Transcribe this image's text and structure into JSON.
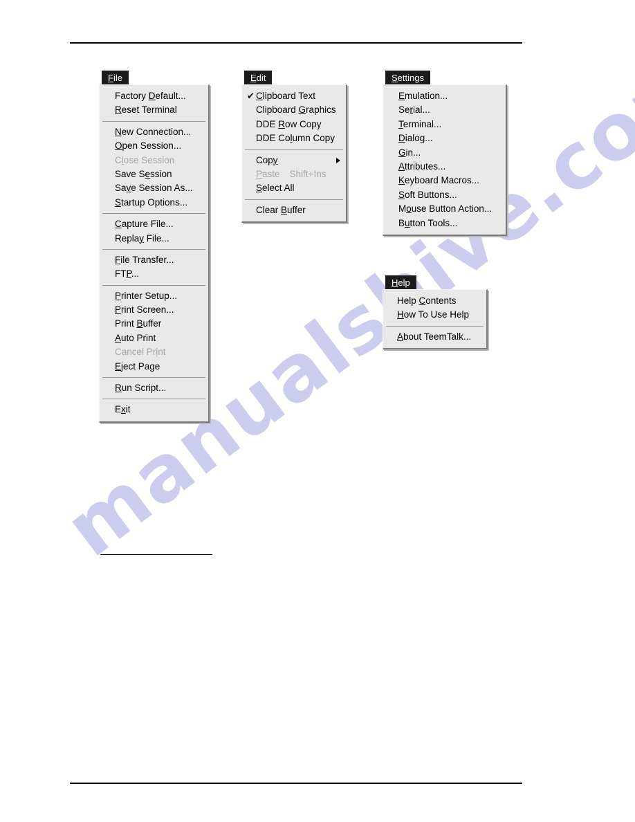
{
  "document": {
    "watermark_text": "manualshive.com",
    "watermark_color": "#ccccee",
    "rule_color": "#000000",
    "menu_bg_color": "#e9e9e9",
    "menu_title_bg_color": "#1c1c1c",
    "disabled_text_color": "#a6a6a6"
  },
  "menus": {
    "file": {
      "title": "File",
      "title_accel": "F",
      "items": [
        {
          "label": "Factory Default...",
          "accel_index": 8,
          "disabled": false
        },
        {
          "label": "Reset Terminal",
          "accel_index": 0,
          "disabled": false
        },
        {
          "separator": true
        },
        {
          "label": "New Connection...",
          "accel_index": 0,
          "disabled": false
        },
        {
          "label": "Open Session...",
          "accel_index": 0,
          "disabled": false
        },
        {
          "label": "Close Session",
          "accel_index": 1,
          "disabled": true
        },
        {
          "label": "Save Session",
          "accel_index": 6,
          "disabled": false
        },
        {
          "label": "Save Session As...",
          "accel_index": 2,
          "disabled": false
        },
        {
          "label": "Startup Options...",
          "accel_index": 0,
          "disabled": false
        },
        {
          "separator": true
        },
        {
          "label": "Capture File...",
          "accel_index": 0,
          "disabled": false
        },
        {
          "label": "Replay File...",
          "accel_index": 5,
          "disabled": false
        },
        {
          "separator": true
        },
        {
          "label": "File Transfer...",
          "accel_index": 0,
          "disabled": false
        },
        {
          "label": "FTP...",
          "accel_index": 2,
          "disabled": false
        },
        {
          "separator": true
        },
        {
          "label": "Printer Setup...",
          "accel_index": 0,
          "disabled": false
        },
        {
          "label": "Print Screen...",
          "accel_index": 0,
          "disabled": false
        },
        {
          "label": "Print Buffer",
          "accel_index": 6,
          "disabled": false
        },
        {
          "label": "Auto Print",
          "accel_index": 0,
          "disabled": false
        },
        {
          "label": "Cancel Print",
          "accel_index": 9,
          "disabled": true
        },
        {
          "label": "Eject Page",
          "accel_index": 0,
          "disabled": false
        },
        {
          "separator": true
        },
        {
          "label": "Run Script...",
          "accel_index": 0,
          "disabled": false
        },
        {
          "separator": true
        },
        {
          "label": "Exit",
          "accel_index": 1,
          "disabled": false
        }
      ]
    },
    "edit": {
      "title": "Edit",
      "title_accel": "E",
      "items": [
        {
          "label": "Clipboard Text",
          "accel_index": 0,
          "disabled": false,
          "checked": true
        },
        {
          "label": "Clipboard Graphics",
          "accel_index": 10,
          "disabled": false
        },
        {
          "label": "DDE Row Copy",
          "accel_index": 4,
          "disabled": false
        },
        {
          "label": "DDE Column Copy",
          "accel_index": 6,
          "disabled": false
        },
        {
          "separator": true
        },
        {
          "label": "Copy",
          "accel_index": 3,
          "disabled": false,
          "submenu": true
        },
        {
          "label": "Paste",
          "accel_index": 0,
          "disabled": true,
          "accel_text": "Shift+Ins"
        },
        {
          "label": "Select All",
          "accel_index": 0,
          "disabled": false
        },
        {
          "separator": true
        },
        {
          "label": "Clear Buffer",
          "accel_index": 6,
          "disabled": false
        }
      ]
    },
    "settings": {
      "title": "Settings",
      "title_accel": "S",
      "items": [
        {
          "label": "Emulation...",
          "accel_index": 0,
          "disabled": false
        },
        {
          "label": "Serial...",
          "accel_index": 2,
          "disabled": false
        },
        {
          "label": "Terminal...",
          "accel_index": 0,
          "disabled": false
        },
        {
          "label": "Dialog...",
          "accel_index": 0,
          "disabled": false
        },
        {
          "label": "Gin...",
          "accel_index": 0,
          "disabled": false
        },
        {
          "label": "Attributes...",
          "accel_index": 0,
          "disabled": false
        },
        {
          "label": "Keyboard Macros...",
          "accel_index": 0,
          "disabled": false
        },
        {
          "label": "Soft Buttons...",
          "accel_index": 0,
          "disabled": false
        },
        {
          "label": "Mouse Button Action...",
          "accel_index": 1,
          "disabled": false
        },
        {
          "label": "Button Tools...",
          "accel_index": 1,
          "disabled": false
        }
      ]
    },
    "help": {
      "title": "Help",
      "title_accel": "H",
      "items": [
        {
          "label": "Help Contents",
          "accel_index": 5,
          "disabled": false
        },
        {
          "label": "How To Use Help",
          "accel_index": 0,
          "disabled": false
        },
        {
          "separator": true
        },
        {
          "label": "About  TeemTalk...",
          "accel_index": 0,
          "disabled": false
        }
      ]
    }
  }
}
